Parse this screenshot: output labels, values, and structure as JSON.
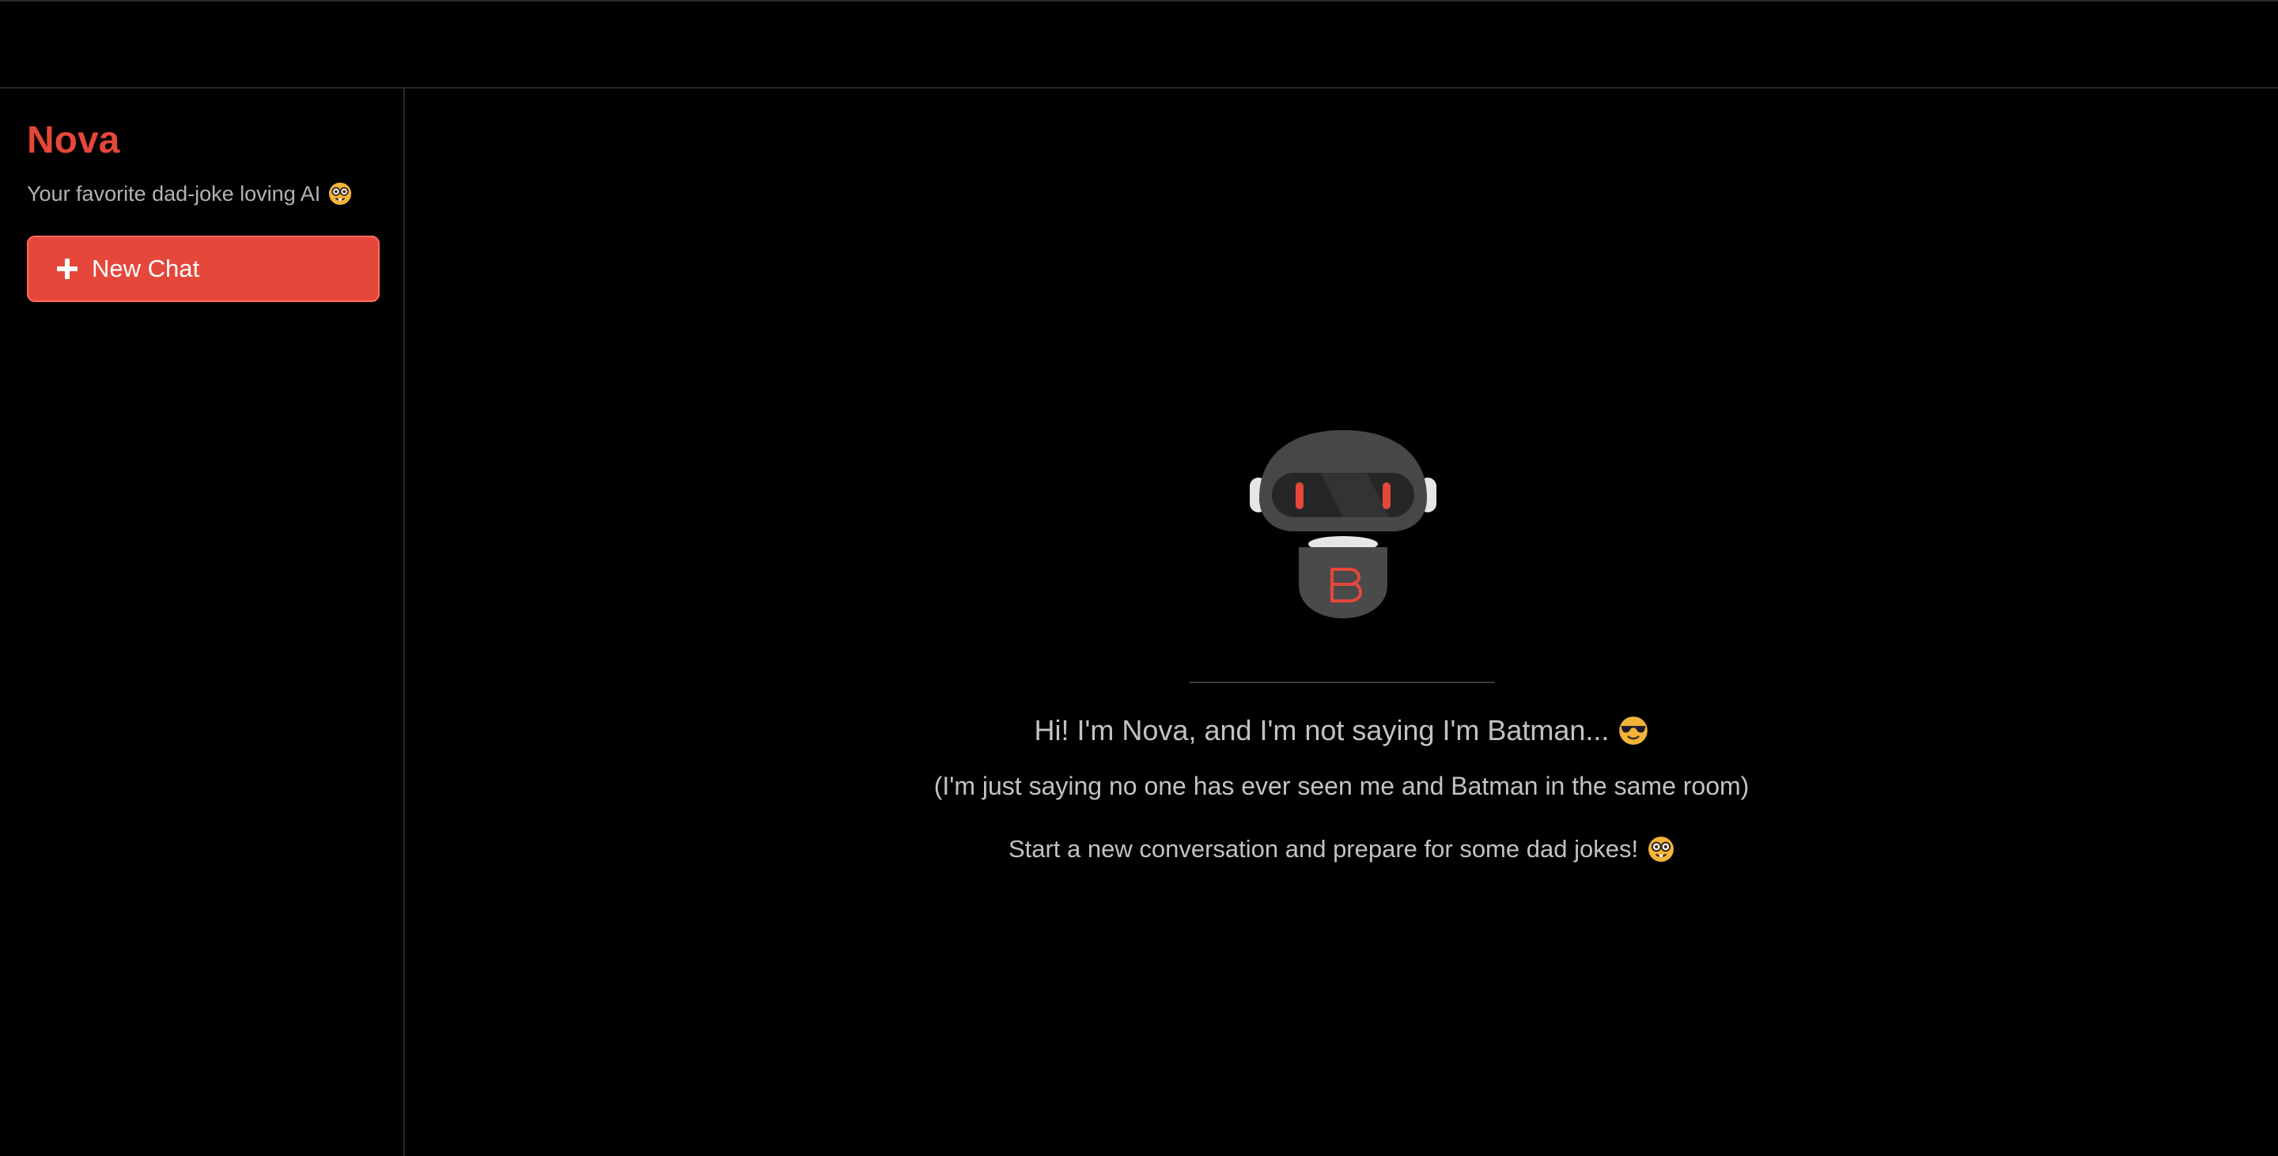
{
  "sidebar": {
    "brand": "Nova",
    "tagline": "Your favorite dad-joke loving AI",
    "tagline_emoji": "nerd-face-emoji",
    "new_chat_label": "New Chat",
    "new_chat_icon": "plus-icon"
  },
  "welcome": {
    "avatar": "robot-avatar",
    "headline": "Hi! I'm Nova, and I'm not saying I'm Batman...",
    "headline_emoji": "sunglasses-face-emoji",
    "subline": "(I'm just saying no one has ever seen me and Batman in the same room)",
    "prompt": "Start a new conversation and prepare for some dad jokes!",
    "prompt_emoji": "nerd-face-emoji"
  },
  "colors": {
    "accent": "#e5473b",
    "background": "#000000",
    "text_muted": "#b3b3b3",
    "robot_body": "#4a4a4a",
    "robot_eye": "#e5473b"
  }
}
